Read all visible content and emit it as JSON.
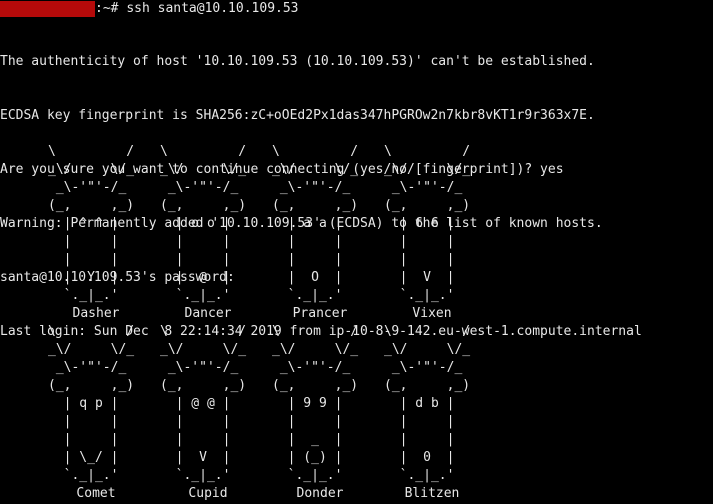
{
  "terminal": {
    "prompt_suffix": ":~# ",
    "command": "ssh santa@10.10.109.53",
    "output_lines": [
      "The authenticity of host '10.10.109.53 (10.10.109.53)' can't be established.",
      "ECDSA key fingerprint is SHA256:zC+oOEd2Px1das347hPGROw2n7kbr8vKT1r9r363x7E.",
      "Are you sure you want to continue connecting (yes/no/[fingerprint])? yes",
      "Warning: Permanently added '10.10.109.53' (ECDSA) to the list of known hosts.",
      "santa@10.10.109.53's password:",
      "Last login: Sun Dec  8 22:14:34 2019 from ip-10-8-9-142.eu-west-1.compute.internal"
    ],
    "colors": {
      "background": "#000000",
      "text": "#e8e8e8",
      "redaction": "#b50a0a"
    }
  },
  "reindeer_rows": [
    [
      {
        "name": "Dasher",
        "art": "\\         /\n_\\/     \\/_\n _\\-'\"'-/_\n(_,     ,_)\n  | ^ ^ |\n  |     |\n  |     |\n  |  Y  |\n  `._|_.'"
      },
      {
        "name": "Dancer",
        "art": "\\         /\n_\\/     \\/_\n _\\-'\"'-/_\n(_,     ,_)\n  | o o |\n  |     |\n  |     |\n  |  @  |\n  `._|_.'"
      },
      {
        "name": "Prancer",
        "art": "\\         /\n_\\/     \\/_\n _\\-'\"'-/_\n(_,     ,_)\n  | a a |\n  |     |\n  |     |\n  |  O  |\n  `._|_.'"
      },
      {
        "name": "Vixen",
        "art": "\\         /\n_\\/     \\/_\n _\\-'\"'-/_\n(_,     ,_)\n  | 6 6 |\n  |     |\n  |     |\n  |  V  |\n  `._|_.'"
      }
    ],
    [
      {
        "name": "Comet",
        "art": "\\         /\n_\\/     \\/_\n _\\-'\"'-/_\n(_,     ,_)\n  | q p |\n  |     |\n  |     |\n  | \\_/ |\n  `._|_.'"
      },
      {
        "name": "Cupid",
        "art": "\\         /\n_\\/     \\/_\n _\\-'\"'-/_\n(_,     ,_)\n  | @ @ |\n  |     |\n  |     |\n  |  V  |\n  `._|_.'"
      },
      {
        "name": "Donder",
        "art": "\\         /\n_\\/     \\/_\n _\\-'\"'-/_\n(_,     ,_)\n  | 9 9 |\n  |     |\n  |  _  |\n  | (_) |\n  `._|_.'"
      },
      {
        "name": "Blitzen",
        "art": "\\         /\n_\\/     \\/_\n _\\-'\"'-/_\n(_,     ,_)\n  | d b |\n  |     |\n  |     |\n  |  0  |\n  `._|_.'"
      }
    ]
  ]
}
